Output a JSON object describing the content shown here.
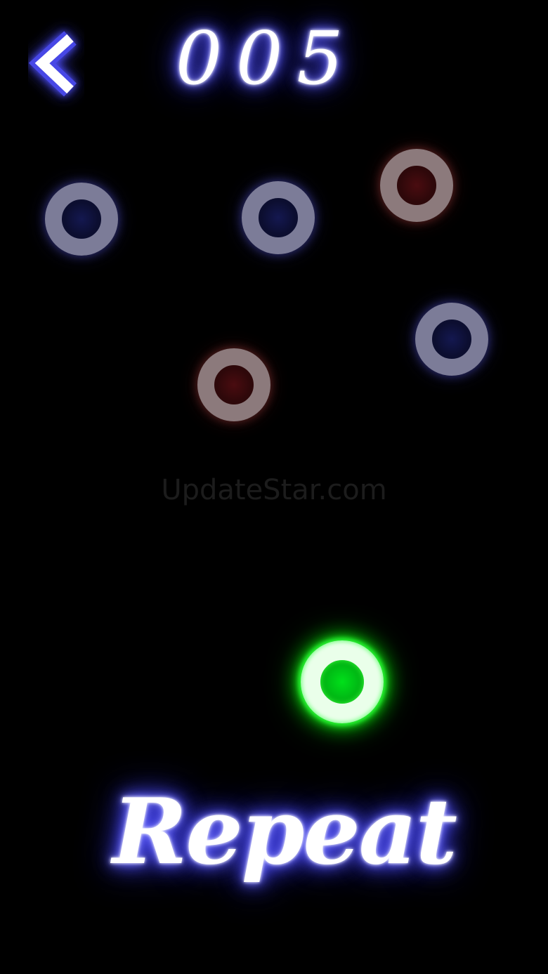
{
  "header": {
    "back_icon": "chevron-left-icon",
    "score": "005"
  },
  "board": {
    "rings": [
      {
        "id": "ring-1",
        "state": "inactive",
        "core_color": "blue"
      },
      {
        "id": "ring-2",
        "state": "inactive",
        "core_color": "blue"
      },
      {
        "id": "ring-3",
        "state": "inactive",
        "core_color": "red"
      },
      {
        "id": "ring-4",
        "state": "inactive",
        "core_color": "blue"
      },
      {
        "id": "ring-5",
        "state": "inactive",
        "core_color": "red"
      }
    ],
    "active_ring": {
      "state": "active",
      "color": "#00e01a"
    }
  },
  "watermark": "UpdateStar.com",
  "footer": {
    "repeat_label": "Repeat"
  },
  "colors": {
    "background": "#000000",
    "neon_blue": "#4646ff",
    "neon_green": "#20ff20"
  }
}
